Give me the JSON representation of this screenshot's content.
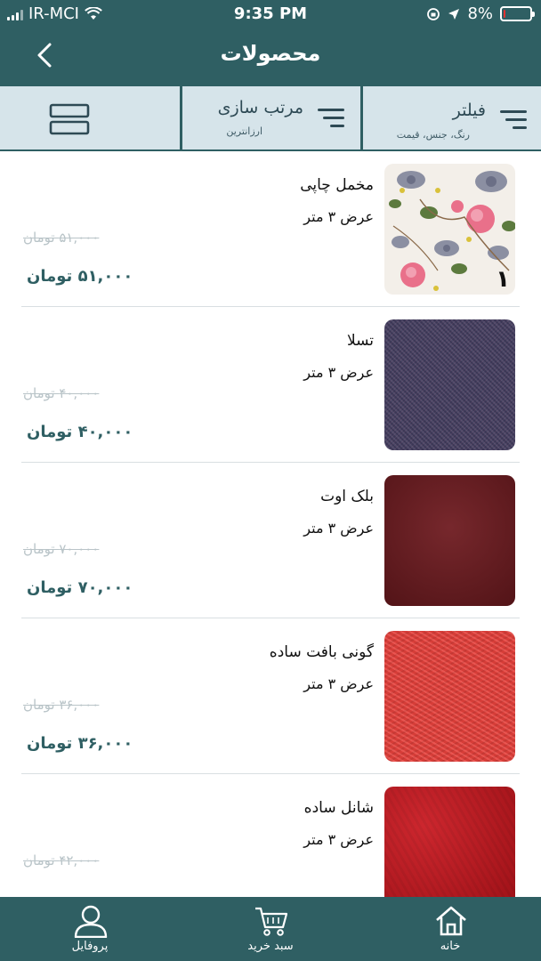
{
  "status_bar": {
    "carrier": "IR-MCI",
    "time": "9:35 PM",
    "battery_percent": "8%",
    "battery_level": 0.08,
    "battery_color": "#e6322f"
  },
  "nav": {
    "title": "محصولات",
    "back_icon": "chevron-left-icon"
  },
  "toolbar": {
    "filter": {
      "label": "فیلتر",
      "sub": "رنگ، جنس، قیمت",
      "icon": "filter-lines-icon"
    },
    "sort": {
      "label": "مرتب سازی",
      "sub": "ارزانترین",
      "icon": "sort-lines-icon"
    },
    "view_icon": "grid-view-icon"
  },
  "products": [
    {
      "name": "مخمل چاپی",
      "width": "عرض ۳ متر",
      "old_price": "۵۱,۰۰۰ تومان",
      "price": "۵۱,۰۰۰ تومان",
      "badge": "۱",
      "swatch": "floral"
    },
    {
      "name": "تسلا",
      "width": "عرض ۳ متر",
      "old_price": "۴۰,۰۰۰ تومان",
      "price": "۴۰,۰۰۰ تومان",
      "swatch": "#3e3a5a"
    },
    {
      "name": "بلک اوت",
      "width": "عرض ۳ متر",
      "old_price": "۷۰,۰۰۰ تومان",
      "price": "۷۰,۰۰۰ تومان",
      "swatch": "#6e1a1f"
    },
    {
      "name": "گونی بافت ساده",
      "width": "عرض ۳ متر",
      "old_price": "۳۶,۰۰۰ تومان",
      "price": "۳۶,۰۰۰ تومان",
      "swatch": "#e8423d"
    },
    {
      "name": "شانل ساده",
      "width": "عرض ۳ متر",
      "old_price": "۴۲,۰۰۰ تومان",
      "price": "",
      "swatch": "#c8141c"
    }
  ],
  "tabbar": {
    "home": {
      "label": "خانه",
      "icon": "home-icon"
    },
    "cart": {
      "label": "سبد خرید",
      "icon": "cart-icon"
    },
    "profile": {
      "label": "پروفایل",
      "icon": "user-icon"
    }
  },
  "colors": {
    "primary": "#2f5f63",
    "toolbar_bg": "#d6e4ea"
  }
}
